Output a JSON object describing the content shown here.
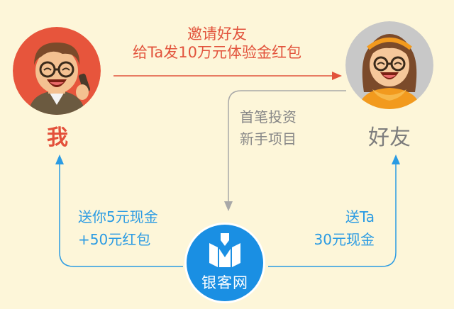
{
  "nodes": {
    "me": {
      "label": "我",
      "color": "#e3503a",
      "avatar_icon": "man-laughing-with-glasses-icon"
    },
    "friend": {
      "label": "好友",
      "color": "#7d7d7d",
      "avatar_icon": "woman-laughing-with-glasses-icon"
    },
    "platform": {
      "label": "银客网",
      "color": "#1a8fe3",
      "logo_icon": "yinke-logo-icon"
    }
  },
  "edges": {
    "invite": {
      "lines": [
        "邀请好友",
        "给Ta发10万元体验金红包"
      ],
      "color": "#e2533c"
    },
    "first_investment": {
      "lines": [
        "首笔投资",
        "新手项目"
      ],
      "color": "#888888"
    },
    "reward_me": {
      "lines": [
        "送你5元现金",
        "+50元红包"
      ],
      "color": "#2a9be3"
    },
    "reward_friend": {
      "lines": [
        "送Ta",
        "30元现金"
      ],
      "color": "#2a9be3"
    }
  },
  "background": "#fdf6d9"
}
